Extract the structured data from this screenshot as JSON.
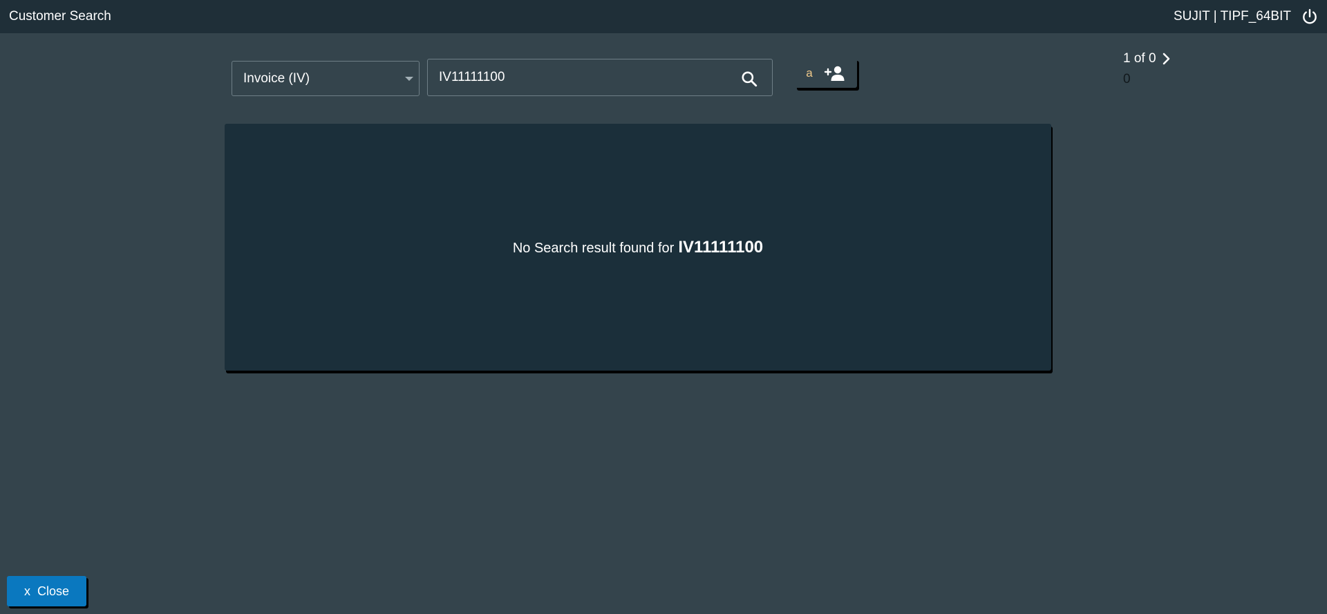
{
  "app": {
    "title": "Customer Search",
    "user_label": "SUJIT | TIPF_64BIT",
    "power_icon": "power-icon"
  },
  "search": {
    "type_selected": "Invoice (IV)",
    "query_value": "IV11111100",
    "search_icon": "search-icon"
  },
  "add_customer": {
    "letter": "a",
    "icon": "add-user-icon",
    "letter_color": "#f0c98a"
  },
  "pager": {
    "text": "1 of 0",
    "count": "0",
    "next_icon": "chevron-right-icon"
  },
  "results": {
    "no_result_label": "No Search result found for",
    "no_result_term": "IV11111100"
  },
  "footer": {
    "close_prefix": "x",
    "close_label": "Close"
  },
  "colors": {
    "background": "#34444c",
    "topbar": "#1f2f38",
    "panel": "#1b2f3a",
    "primary_button": "#0a78bf"
  }
}
